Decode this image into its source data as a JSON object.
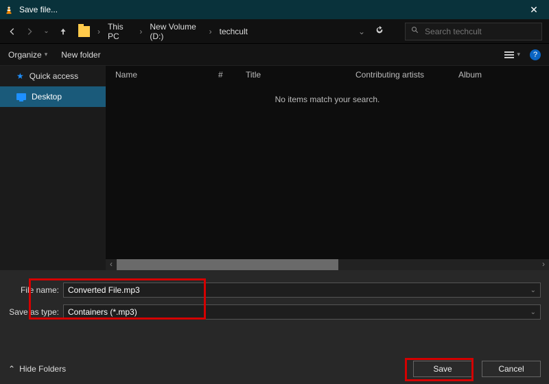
{
  "window": {
    "title": "Save file..."
  },
  "breadcrumb": {
    "root": "This PC",
    "mid": "New Volume (D:)",
    "leaf": "techcult"
  },
  "search": {
    "placeholder": "Search techcult"
  },
  "toolbar": {
    "organize": "Organize",
    "newfolder": "New folder",
    "help": "?"
  },
  "sidebar": {
    "quick": "Quick access",
    "desktop": "Desktop"
  },
  "columns": {
    "name": "Name",
    "num": "#",
    "title": "Title",
    "contrib": "Contributing artists",
    "album": "Album"
  },
  "empty_msg": "No items match your search.",
  "fields": {
    "filename_label": "File name:",
    "filename_value": "Converted File.mp3",
    "savetype_label": "Save as type:",
    "savetype_value": "Containers (*.mp3)"
  },
  "buttons": {
    "hide": "Hide Folders",
    "save": "Save",
    "cancel": "Cancel"
  }
}
